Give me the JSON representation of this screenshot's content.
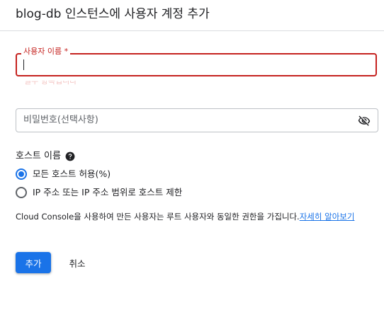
{
  "dialog": {
    "title": "blog-db 인스턴스에 사용자 계정 추가"
  },
  "username_field": {
    "label": "사용자 이름 *",
    "value": "",
    "error": "필수 항목입니다"
  },
  "password_field": {
    "placeholder": "비밀번호(선택사항)",
    "toggle_icon": "visibility-off-icon"
  },
  "host": {
    "heading": "호스트 이름",
    "help_icon": "help-icon",
    "options": [
      {
        "label": "모든 호스트 허용(%)",
        "selected": true
      },
      {
        "label": "IP 주소 또는 IP 주소 범위로 호스트 제한",
        "selected": false
      }
    ]
  },
  "info": {
    "text": "Cloud Console을 사용하여 만든 사용자는 루트 사용자와 동일한 권한을 가집니다.",
    "link": "자세히 알아보기"
  },
  "actions": {
    "add_label": "추가",
    "cancel_label": "취소"
  },
  "colors": {
    "accent": "#1a73e8",
    "error": "#c5221f"
  }
}
